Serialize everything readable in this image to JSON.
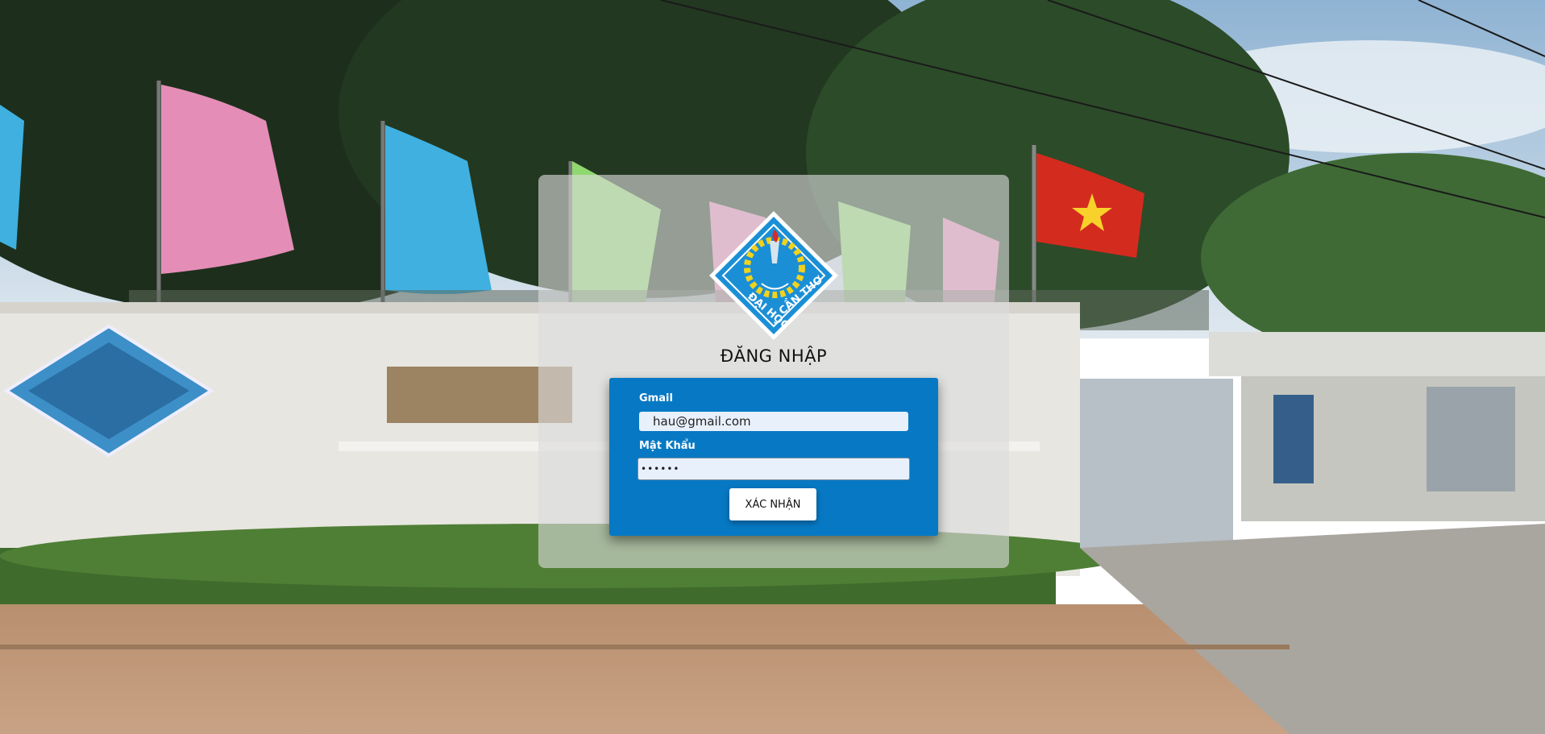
{
  "page": {
    "title": "ĐĂNG NHẬP"
  },
  "logo": {
    "text_left": "ĐẠI HỌC",
    "text_right": "CẦN THƠ",
    "colors": {
      "primary": "#1b8fd6",
      "border": "#ffffff",
      "gear": "#f2d21b",
      "torch": "#d42c2c"
    }
  },
  "form": {
    "gmail_label": "Gmail",
    "gmail_value": "hau@gmail.com",
    "password_label": "Mật Khẩu",
    "password_value": "hau123",
    "submit_label": "XÁC NHẬN"
  },
  "theme": {
    "panel_color": "#0779c4",
    "card_color": "#dcdcdc"
  }
}
